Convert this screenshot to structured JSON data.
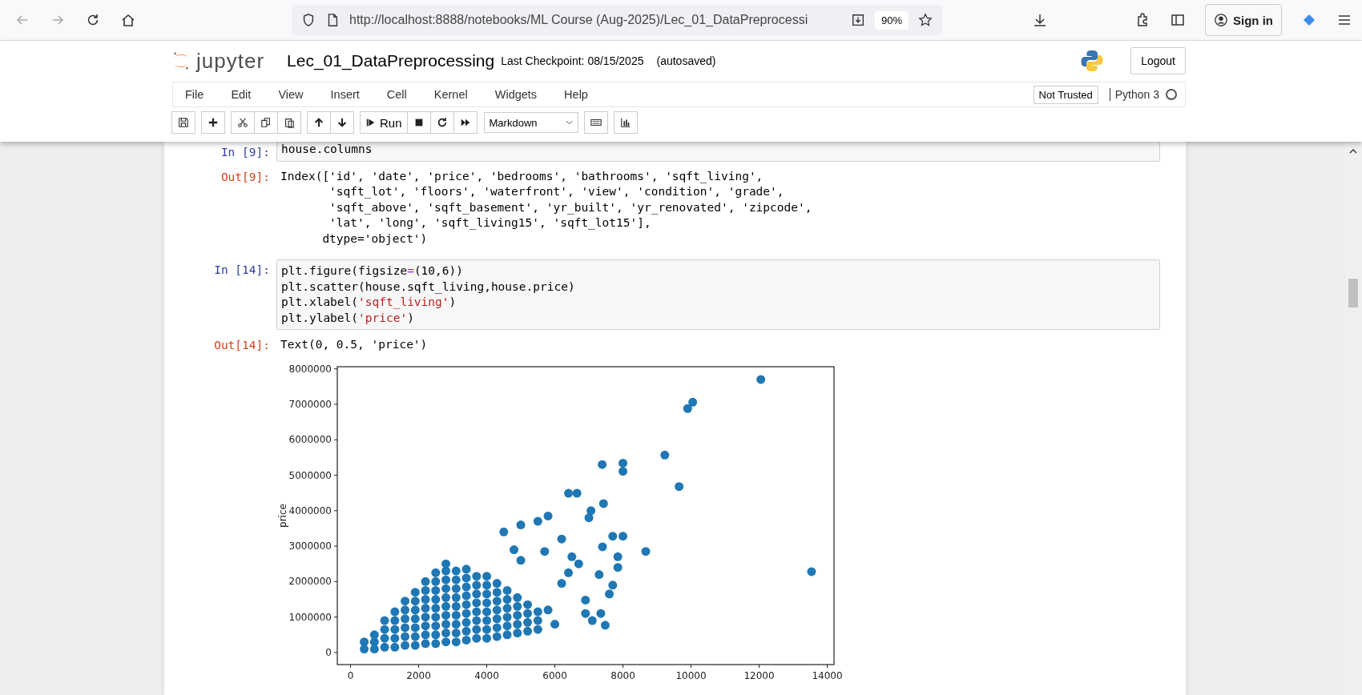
{
  "browser": {
    "url": "http://localhost:8888/notebooks/ML Course (Aug-2025)/Lec_01_DataPreprocessi",
    "zoom": "90%",
    "sign_in": "Sign in"
  },
  "header": {
    "logo_text": "jupyter",
    "title": "Lec_01_DataPreprocessing",
    "checkpoint": "Last Checkpoint: 08/15/2025",
    "autosaved": "(autosaved)",
    "logout": "Logout"
  },
  "menu": [
    "File",
    "Edit",
    "View",
    "Insert",
    "Cell",
    "Kernel",
    "Widgets",
    "Help"
  ],
  "trust": "Not Trusted",
  "kernel": "Python 3",
  "toolbar": {
    "run_label": "Run",
    "cell_type": "Markdown"
  },
  "cells": [
    {
      "kind": "input",
      "prompt": "In [9]:",
      "lines": [
        [
          {
            "t": "house.columns",
            "kind": "plain"
          }
        ]
      ]
    },
    {
      "kind": "output",
      "prompt": "Out[9]:",
      "lines": [
        "Index(['id', 'date', 'price', 'bedrooms', 'bathrooms', 'sqft_living',",
        "       'sqft_lot', 'floors', 'waterfront', 'view', 'condition', 'grade',",
        "       'sqft_above', 'sqft_basement', 'yr_built', 'yr_renovated', 'zipcode',",
        "       'lat', 'long', 'sqft_living15', 'sqft_lot15'],",
        "      dtype='object')"
      ]
    },
    {
      "kind": "input",
      "prompt": "In [14]:",
      "lines": [
        [
          {
            "t": "plt.figure(figsize",
            "kind": "plain"
          },
          {
            "t": "=",
            "kind": "op"
          },
          {
            "t": "(10,6))",
            "kind": "plain"
          }
        ],
        [
          {
            "t": "plt.scatter(house.sqft_living,house.price)",
            "kind": "plain"
          }
        ],
        [
          {
            "t": "plt.xlabel(",
            "kind": "plain"
          },
          {
            "t": "'sqft_living'",
            "kind": "string"
          },
          {
            "t": ")",
            "kind": "plain"
          }
        ],
        [
          {
            "t": "plt.ylabel(",
            "kind": "plain"
          },
          {
            "t": "'price'",
            "kind": "string"
          },
          {
            "t": ")",
            "kind": "plain"
          }
        ]
      ]
    },
    {
      "kind": "output",
      "prompt": "Out[14]:",
      "lines": [
        "Text(0, 0.5, 'price')"
      ]
    },
    {
      "kind": "chart",
      "chart_data": {
        "type": "scatter",
        "ylabel": "price",
        "xlim": [
          -390,
          14200
        ],
        "ylim": [
          -340000,
          8060000
        ],
        "xticks": [
          0,
          2000,
          4000,
          6000,
          8000,
          10000,
          12000,
          14000
        ],
        "yticks": [
          0,
          1000000,
          2000000,
          3000000,
          4000000,
          5000000,
          6000000,
          7000000,
          8000000
        ],
        "x": [
          400,
          400,
          700,
          700,
          700,
          1000,
          1000,
          1000,
          1000,
          1300,
          1300,
          1300,
          1300,
          1300,
          1600,
          1600,
          1600,
          1600,
          1600,
          1600,
          1900,
          1900,
          1900,
          1900,
          1900,
          1900,
          1900,
          2200,
          2200,
          2200,
          2200,
          2200,
          2200,
          2200,
          2200,
          2500,
          2500,
          2500,
          2500,
          2500,
          2500,
          2500,
          2500,
          2500,
          2800,
          2800,
          2800,
          2800,
          2800,
          2800,
          2800,
          2800,
          2800,
          2800,
          3100,
          3100,
          3100,
          3100,
          3100,
          3100,
          3100,
          3100,
          3100,
          3400,
          3400,
          3400,
          3400,
          3400,
          3400,
          3400,
          3400,
          3400,
          3700,
          3700,
          3700,
          3700,
          3700,
          3700,
          3700,
          3700,
          4000,
          4000,
          4000,
          4000,
          4000,
          4000,
          4000,
          4000,
          4300,
          4300,
          4300,
          4300,
          4300,
          4300,
          4300,
          4600,
          4600,
          4600,
          4600,
          4600,
          4600,
          4900,
          4900,
          4900,
          4900,
          4900,
          5200,
          5200,
          5200,
          5200,
          5500,
          5500,
          5500,
          12050,
          10050,
          9900,
          9230,
          9650,
          8000,
          8000,
          7390,
          6400,
          6650,
          7430,
          7060,
          7000,
          13540,
          8670,
          8000,
          7700,
          7400,
          7850,
          7850,
          7300,
          7700,
          7600,
          6900,
          7100,
          7480,
          7350,
          6900,
          6200,
          6200,
          5800,
          5500,
          5000,
          4500,
          6500,
          6400,
          6700,
          5700,
          6000,
          5800,
          5000,
          4800
        ],
        "values": [
          100000,
          300000,
          100000,
          300000,
          500000,
          150000,
          400000,
          650000,
          900000,
          150000,
          400000,
          650000,
          900000,
          1150000,
          200000,
          450000,
          700000,
          950000,
          1200000,
          1450000,
          200000,
          450000,
          700000,
          950000,
          1200000,
          1450000,
          1700000,
          250000,
          500000,
          750000,
          1000000,
          1250000,
          1500000,
          1750000,
          2000000,
          250000,
          500000,
          750000,
          1000000,
          1250000,
          1500000,
          1750000,
          2000000,
          2250000,
          300000,
          550000,
          800000,
          1050000,
          1300000,
          1550000,
          1800000,
          2050000,
          2300000,
          2500000,
          300000,
          550000,
          800000,
          1050000,
          1300000,
          1550000,
          1800000,
          2050000,
          2300000,
          350000,
          600000,
          850000,
          1100000,
          1350000,
          1600000,
          1850000,
          2100000,
          2350000,
          400000,
          650000,
          900000,
          1150000,
          1400000,
          1650000,
          1900000,
          2150000,
          400000,
          650000,
          900000,
          1150000,
          1400000,
          1650000,
          1900000,
          2150000,
          450000,
          700000,
          950000,
          1200000,
          1450000,
          1700000,
          1950000,
          500000,
          750000,
          1000000,
          1250000,
          1500000,
          1750000,
          550000,
          800000,
          1050000,
          1300000,
          1550000,
          600000,
          850000,
          1100000,
          1350000,
          650000,
          900000,
          1150000,
          7700000,
          7060000,
          6880000,
          5570000,
          4680000,
          5340000,
          5110000,
          5300000,
          4490000,
          4490000,
          4200000,
          4000000,
          3800000,
          2280000,
          2850000,
          3280000,
          3280000,
          2980000,
          2700000,
          2400000,
          2200000,
          1900000,
          1650000,
          1480000,
          900000,
          770000,
          1100000,
          1100000,
          3200000,
          1950000,
          3850000,
          3700000,
          3600000,
          3400000,
          2700000,
          2250000,
          2500000,
          2850000,
          800000,
          1200000,
          2600000,
          2900000
        ]
      }
    }
  ]
}
